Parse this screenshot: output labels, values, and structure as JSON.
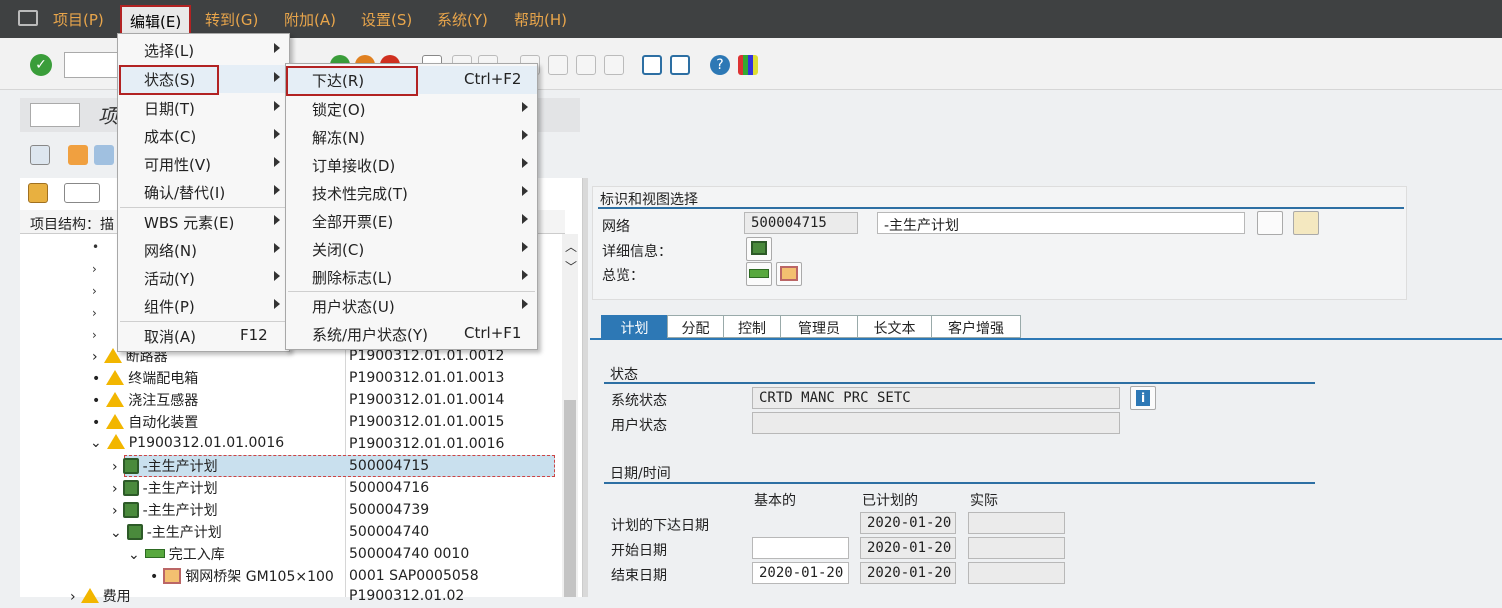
{
  "menubar": {
    "items": [
      "项目(P)",
      "编辑(E)",
      "转到(G)",
      "附加(A)",
      "设置(S)",
      "系统(Y)",
      "帮助(H)"
    ]
  },
  "title": {
    "text": "项"
  },
  "left_pane": {
    "header_label": "项目结构：描",
    "rows": [
      {
        "name": "断路器",
        "code": "P1900312.01.01.0012"
      },
      {
        "name": "终端配电箱",
        "code": "P1900312.01.01.0013"
      },
      {
        "name": "浇注互感器",
        "code": "P1900312.01.01.0014"
      },
      {
        "name": "自动化装置",
        "code": "P1900312.01.01.0015"
      },
      {
        "name": "P1900312.01.01.0016",
        "code": "P1900312.01.01.0016"
      },
      {
        "name": "-主生产计划",
        "code": "500004715"
      },
      {
        "name": "-主生产计划",
        "code": "500004716"
      },
      {
        "name": "-主生产计划",
        "code": "500004739"
      },
      {
        "name": "-主生产计划",
        "code": "500004740"
      },
      {
        "name": "完工入库",
        "code": "500004740 0010"
      },
      {
        "name": "钢网桥架 GM105×100",
        "code": "0001 SAP0005058"
      },
      {
        "name": "费用",
        "code": "P1900312.01.02"
      }
    ]
  },
  "edit_menu": {
    "items": [
      {
        "label": "选择(L)"
      },
      {
        "label": "状态(S)"
      },
      {
        "label": "日期(T)"
      },
      {
        "label": "成本(C)"
      },
      {
        "label": "可用性(V)"
      },
      {
        "label": "确认/替代(I)"
      },
      {
        "label": "WBS 元素(E)"
      },
      {
        "label": "网络(N)"
      },
      {
        "label": "活动(Y)"
      },
      {
        "label": "组件(P)"
      },
      {
        "label": "取消(A)",
        "shortcut": "F12"
      }
    ]
  },
  "status_menu": {
    "items": [
      {
        "label": "下达(R)",
        "shortcut": "Ctrl+F2"
      },
      {
        "label": "锁定(O)"
      },
      {
        "label": "解冻(N)"
      },
      {
        "label": "订单接收(D)"
      },
      {
        "label": "技术性完成(T)"
      },
      {
        "label": "全部开票(E)"
      },
      {
        "label": "关闭(C)"
      },
      {
        "label": "删除标志(L)"
      },
      {
        "label": "用户状态(U)"
      },
      {
        "label": "系统/用户状态(Y)",
        "shortcut": "Ctrl+F1"
      }
    ]
  },
  "ident": {
    "group_title": "标识和视图选择",
    "network_label": "网络",
    "network_value": "500004715",
    "network_desc": "-主生产计划",
    "detail_label": "详细信息：",
    "overview_label": "总览："
  },
  "tabs": [
    "计划",
    "分配",
    "控制",
    "管理员",
    "长文本",
    "客户增强"
  ],
  "status": {
    "group_title": "状态",
    "system_label": "系统状态",
    "system_value": "CRTD MANC PRC  SETC",
    "user_label": "用户状态",
    "user_value": ""
  },
  "dates": {
    "group_title": "日期/时间",
    "col_basic": "基本的",
    "col_planned": "已计划的",
    "col_actual": "实际",
    "rows": [
      {
        "label": "计划的下达日期",
        "planned": "2020-01-20"
      },
      {
        "label": "开始日期",
        "basic": "",
        "planned": "2020-01-20"
      },
      {
        "label": "结束日期",
        "basic": "2020-01-20",
        "planned": "2020-01-20"
      }
    ]
  },
  "colors": {
    "accent": "#2d78b5",
    "menubar": "#3f4142",
    "menubar_text": "#e8a54b",
    "highlight_box": "#b22222"
  }
}
